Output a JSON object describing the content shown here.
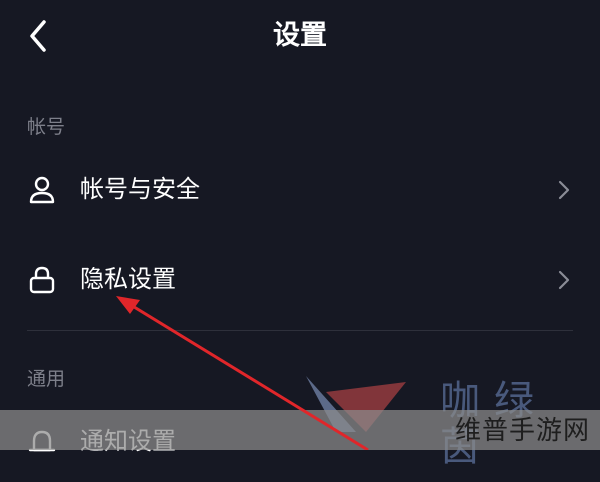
{
  "header": {
    "title": "设置"
  },
  "sections": [
    {
      "label": "帐号"
    },
    {
      "label": "通用"
    }
  ],
  "items": {
    "account_security": "帐号与安全",
    "privacy_settings": "隐私设置",
    "notification_settings": "通知设置"
  },
  "watermark": {
    "brand": "咖绿茵",
    "site": "维普手游网"
  },
  "icons": [
    "back-chevron-icon",
    "user-icon",
    "lock-icon",
    "bell-icon",
    "chevron-right-icon"
  ],
  "colors": {
    "background": "#161823",
    "text": "#ffffff",
    "muted": "#7d7f8a",
    "arrow": "#e0262a"
  }
}
